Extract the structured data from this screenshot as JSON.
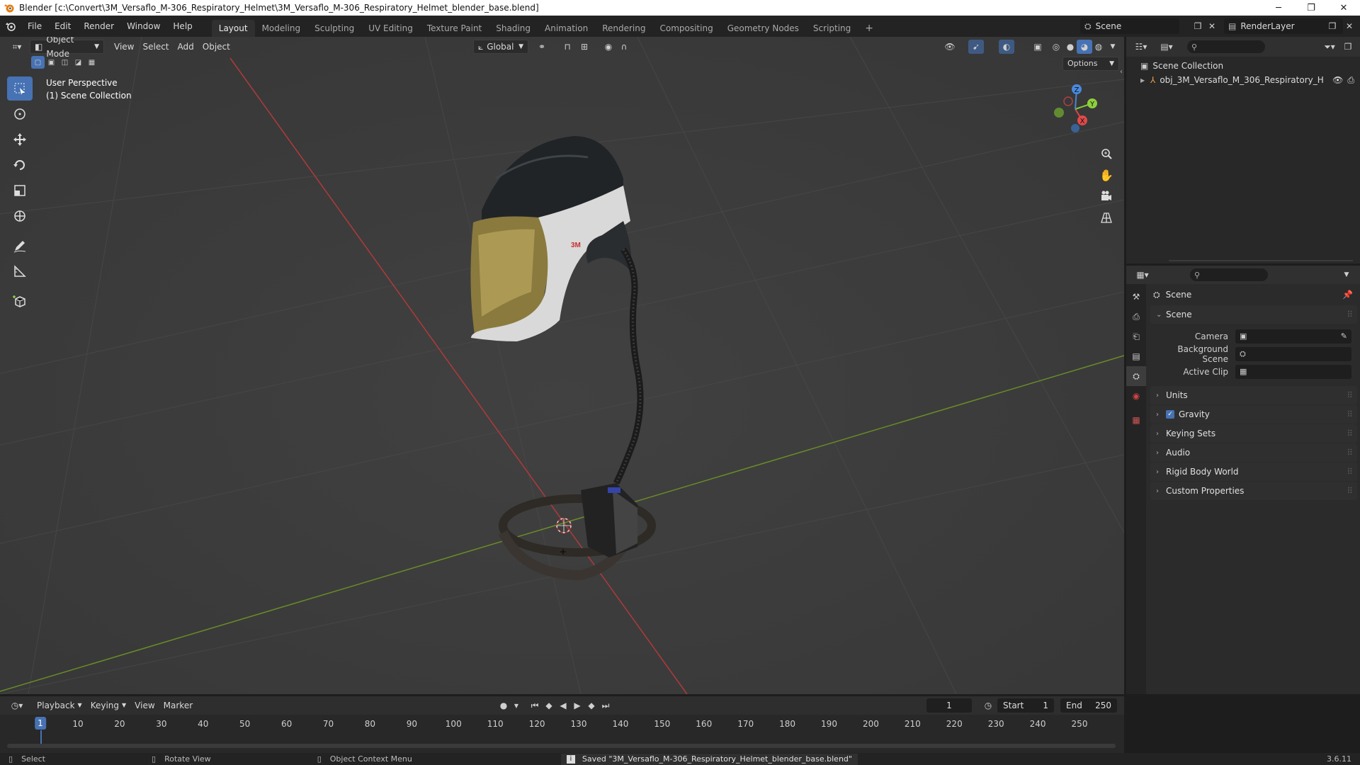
{
  "window": {
    "title": "Blender [c:\\Convert\\3M_Versaflo_M-306_Respiratory_Helmet\\3M_Versaflo_M-306_Respiratory_Helmet_blender_base.blend]",
    "minimize": "─",
    "maximize": "❐",
    "close": "✕"
  },
  "menu": [
    "File",
    "Edit",
    "Render",
    "Window",
    "Help"
  ],
  "workspaces": {
    "tabs": [
      "Layout",
      "Modeling",
      "Sculpting",
      "UV Editing",
      "Texture Paint",
      "Shading",
      "Animation",
      "Rendering",
      "Compositing",
      "Geometry Nodes",
      "Scripting"
    ],
    "active_index": 0,
    "add": "+"
  },
  "scene_selector": {
    "value": "Scene"
  },
  "render_layer": {
    "value": "RenderLayer"
  },
  "viewport": {
    "mode": "Object Mode",
    "menus": [
      "View",
      "Select",
      "Add",
      "Object"
    ],
    "orientation": "Global",
    "options_label": "Options",
    "overlay_line1": "User Perspective",
    "overlay_line2": "(1) Scene Collection",
    "gizmo_labels": {
      "x": "X",
      "y": "Y",
      "z": "Z"
    },
    "colors": {
      "x_axis": "#b03a3a",
      "y_axis": "#6a8c27",
      "background": "#3b3b3b",
      "active_tool": "#4772b3"
    }
  },
  "outliner": {
    "root": "Scene Collection",
    "items": [
      {
        "label": "obj_3M_Versaflo_M_306_Respiratory_H"
      }
    ]
  },
  "properties": {
    "context_title": "Scene",
    "panel_scene": "Scene",
    "fields": [
      {
        "label": "Camera"
      },
      {
        "label": "Background Scene"
      },
      {
        "label": "Active Clip"
      }
    ],
    "subpanels": [
      {
        "label": "Units",
        "checkbox": false
      },
      {
        "label": "Gravity",
        "checkbox": true
      },
      {
        "label": "Keying Sets",
        "checkbox": false
      },
      {
        "label": "Audio",
        "checkbox": false
      },
      {
        "label": "Rigid Body World",
        "checkbox": false
      },
      {
        "label": "Custom Properties",
        "checkbox": false
      }
    ]
  },
  "timeline": {
    "menus": [
      "Playback",
      "Keying",
      "View",
      "Marker"
    ],
    "current_frame": "1",
    "start_label": "Start",
    "start": "1",
    "end_label": "End",
    "end": "250",
    "ruler": [
      "1",
      "10",
      "20",
      "30",
      "40",
      "50",
      "60",
      "70",
      "80",
      "90",
      "100",
      "110",
      "120",
      "130",
      "140",
      "150",
      "160",
      "170",
      "180",
      "190",
      "200",
      "210",
      "220",
      "230",
      "240",
      "250"
    ]
  },
  "statusbar": {
    "select": "Select",
    "rotate": "Rotate View",
    "context_menu": "Object Context Menu",
    "message": "Saved \"3M_Versaflo_M-306_Respiratory_Helmet_blender_base.blend\"",
    "version": "3.6.11"
  }
}
